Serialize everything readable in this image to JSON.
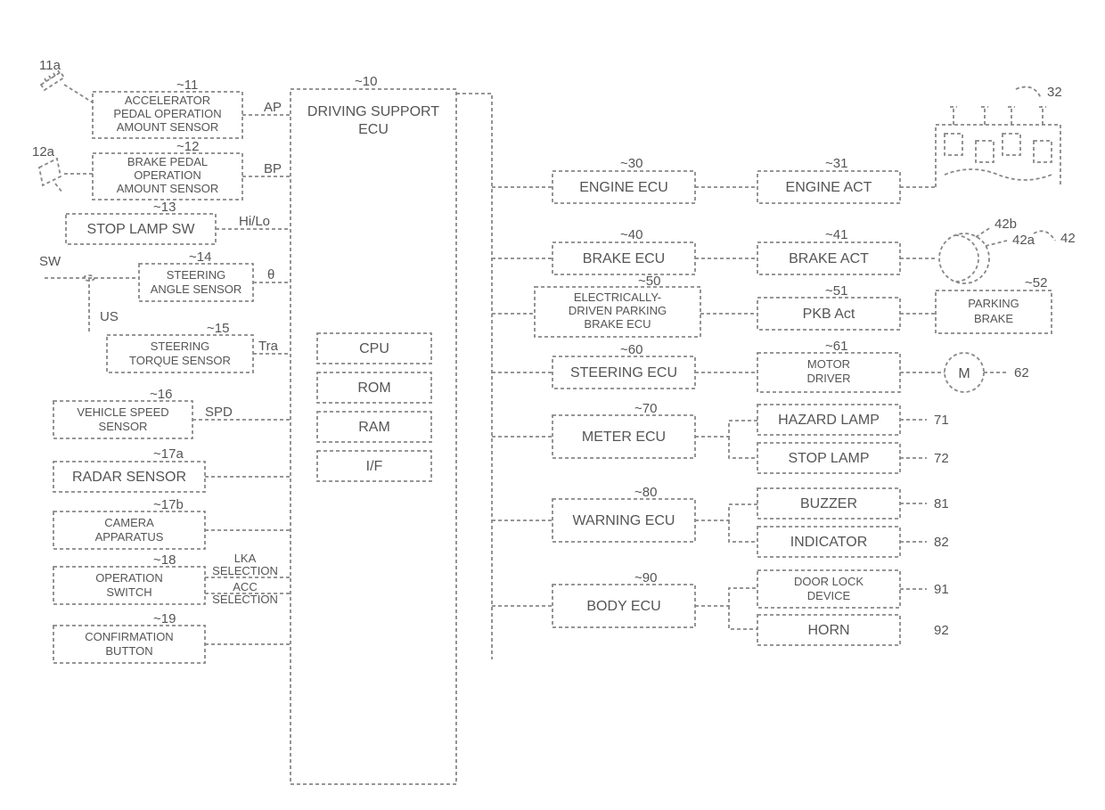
{
  "main": {
    "id": "10",
    "title_l1": "DRIVING SUPPORT",
    "title_l2": "ECU",
    "cpu": "CPU",
    "rom": "ROM",
    "ram": "RAM",
    "if": "I/F"
  },
  "left": {
    "accel": {
      "id": "11",
      "icon_id": "11a",
      "l1": "ACCELERATOR",
      "l2": "PEDAL OPERATION",
      "l3": "AMOUNT SENSOR",
      "sig": "AP"
    },
    "brake": {
      "id": "12",
      "icon_id": "12a",
      "l1": "BRAKE PEDAL",
      "l2": "OPERATION",
      "l3": "AMOUNT SENSOR",
      "sig": "BP"
    },
    "stop": {
      "id": "13",
      "label": "STOP LAMP SW",
      "sig": "Hi/Lo"
    },
    "steer_ang": {
      "id": "14",
      "l1": "STEERING",
      "l2": "ANGLE SENSOR",
      "sig": "θ",
      "sw": "SW",
      "us": "US"
    },
    "steer_trq": {
      "id": "15",
      "l1": "STEERING",
      "l2": "TORQUE SENSOR",
      "sig": "Tra"
    },
    "speed": {
      "id": "16",
      "l1": "VEHICLE SPEED",
      "l2": "SENSOR",
      "sig": "SPD"
    },
    "radar": {
      "id": "17a",
      "label": "RADAR SENSOR"
    },
    "camera": {
      "id": "17b",
      "l1": "CAMERA",
      "l2": "APPARATUS"
    },
    "opsw": {
      "id": "18",
      "l1": "OPERATION",
      "l2": "SWITCH",
      "sig1": "LKA",
      "sig2": "SELECTION",
      "sig3": "ACC",
      "sig4": "SELECTION"
    },
    "confirm": {
      "id": "19",
      "l1": "CONFIRMATION",
      "l2": "BUTTON"
    }
  },
  "right": {
    "engine": {
      "ecu_id": "30",
      "ecu": "ENGINE ECU",
      "act_id": "31",
      "act": "ENGINE ACT",
      "dev_id": "32"
    },
    "brake": {
      "ecu_id": "40",
      "ecu": "BRAKE ECU",
      "act_id": "41",
      "act": "BRAKE ACT",
      "dev_id": "42",
      "a": "42a",
      "b": "42b"
    },
    "pkb": {
      "ecu_id": "50",
      "ecu_l1": "ELECTRICALLY-",
      "ecu_l2": "DRIVEN PARKING",
      "ecu_l3": "BRAKE ECU",
      "act_id": "51",
      "act": "PKB   Act",
      "dev_id": "52",
      "dev_l1": "PARKING",
      "dev_l2": "BRAKE"
    },
    "steer": {
      "ecu_id": "60",
      "ecu": "STEERING ECU",
      "act_id": "61",
      "act_l1": "MOTOR",
      "act_l2": "DRIVER",
      "dev_id": "62",
      "dev": "M"
    },
    "meter": {
      "ecu_id": "70",
      "ecu": "METER ECU",
      "d1_id": "71",
      "d1": "HAZARD LAMP",
      "d2_id": "72",
      "d2": "STOP LAMP"
    },
    "warn": {
      "ecu_id": "80",
      "ecu": "WARNING ECU",
      "d1_id": "81",
      "d1": "BUZZER",
      "d2_id": "82",
      "d2": "INDICATOR"
    },
    "body": {
      "ecu_id": "90",
      "ecu": "BODY ECU",
      "d1_id": "91",
      "d1_l1": "DOOR LOCK",
      "d1_l2": "DEVICE",
      "d2_id": "92",
      "d2": "HORN"
    }
  }
}
